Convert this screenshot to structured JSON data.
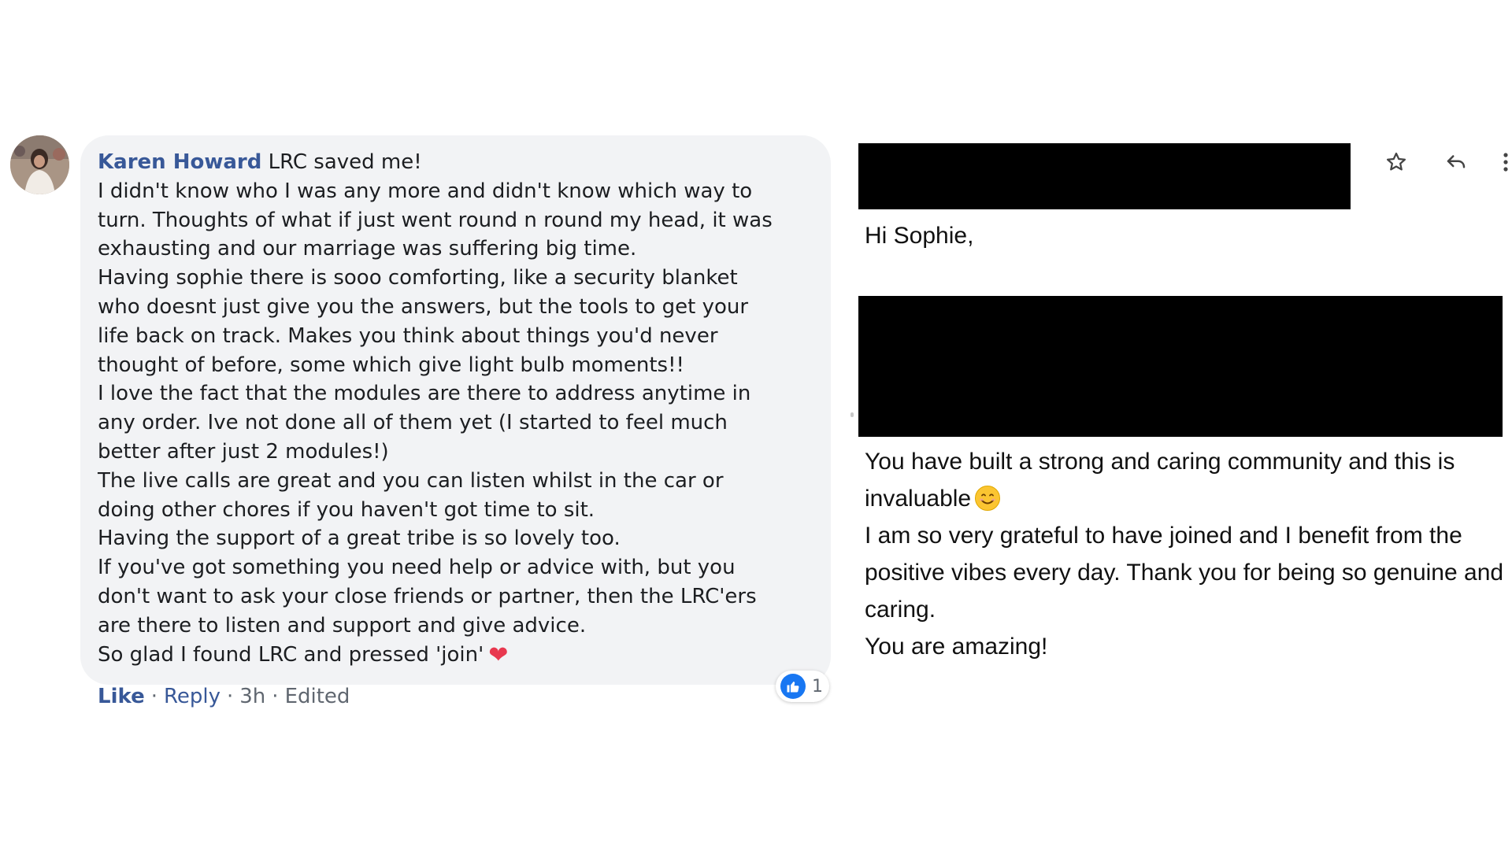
{
  "comment": {
    "author": "Karen Howard",
    "first_line": " LRC saved me!",
    "body": "I didn't know who I was any more and didn't know which way to\nturn. Thoughts of what if just went round n round my head, it was\nexhausting and our marriage was suffering big time.\nHaving sophie there is sooo comforting, like a security blanket\nwho doesnt just give you the answers, but the tools to get your\nlife back on track. Makes you think about things you'd never\nthought of before, some which give light bulb moments!!\nI love the fact that the modules are there to address anytime in\nany order. Ive not done all of them yet (I started to feel much\nbetter after just 2 modules!)\nThe live calls are great and you can listen whilst in the car or\ndoing other chores if you haven't got time to sit.\nHaving the support of a great tribe is so lovely too.\nIf you've got something you need help or advice with, but you\ndon't want to ask your close friends or partner, then the LRC'ers\nare there to listen and support and give advice.\nSo glad I found LRC and pressed 'join'",
    "heart_emoji": "❤",
    "reaction_count": "1",
    "actions": {
      "like": "Like",
      "reply": "Reply",
      "time": "3h",
      "edited": "Edited",
      "separator": "·"
    },
    "colors": {
      "bubble": "#f2f3f5",
      "author": "#385898",
      "like_blue": "#1877f2"
    }
  },
  "email": {
    "greeting": "Hi Sophie,",
    "paragraphs": [
      "You have built a strong and caring community and this is invaluable",
      "I am so very grateful to have joined and I benefit from the positive vibes every day. Thank you for being so genuine and caring.",
      "You are amazing!"
    ],
    "icons": [
      "star-icon",
      "reply-icon",
      "more-vertical-icon"
    ]
  }
}
